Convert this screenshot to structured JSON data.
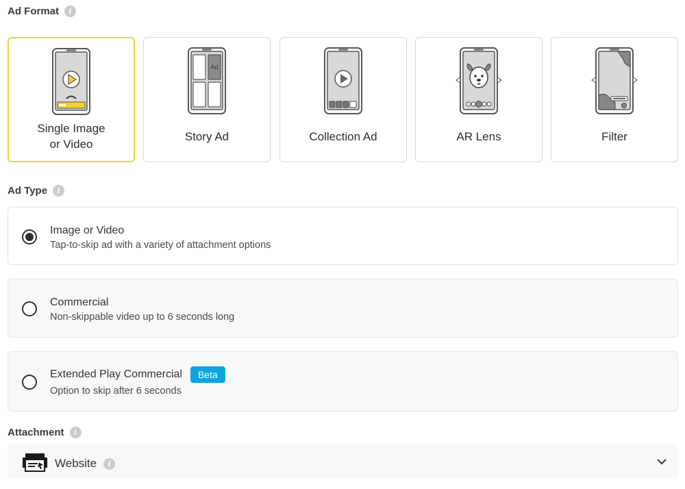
{
  "ad_format": {
    "label": "Ad Format",
    "options": [
      {
        "line1": "Single Image",
        "line2": "or Video",
        "icon": "single-image-phone-icon",
        "selected": true
      },
      {
        "line1": "Story Ad",
        "icon": "story-ad-phone-icon",
        "selected": false
      },
      {
        "line1": "Collection Ad",
        "icon": "collection-ad-phone-icon",
        "selected": false
      },
      {
        "line1": "AR Lens",
        "icon": "ar-lens-phone-icon",
        "selected": false
      },
      {
        "line1": "Filter",
        "icon": "filter-phone-icon",
        "selected": false
      }
    ],
    "story_ad_tag": "Ad"
  },
  "ad_type": {
    "label": "Ad Type",
    "options": [
      {
        "title": "Image or Video",
        "description": "Tap-to-skip ad with a variety of attachment options",
        "selected": true
      },
      {
        "title": "Commercial",
        "description": "Non-skippable video up to 6 seconds long",
        "selected": false
      },
      {
        "title": "Extended Play Commercial",
        "badge": "Beta",
        "description": "Option to skip after 6 seconds",
        "selected": false
      }
    ]
  },
  "attachment": {
    "label": "Attachment",
    "value": "Website",
    "icon": "website-icon"
  },
  "colors": {
    "selected_border": "#f2d22e",
    "badge": "#0fa3e2",
    "info_icon": "#c9cbcf"
  }
}
